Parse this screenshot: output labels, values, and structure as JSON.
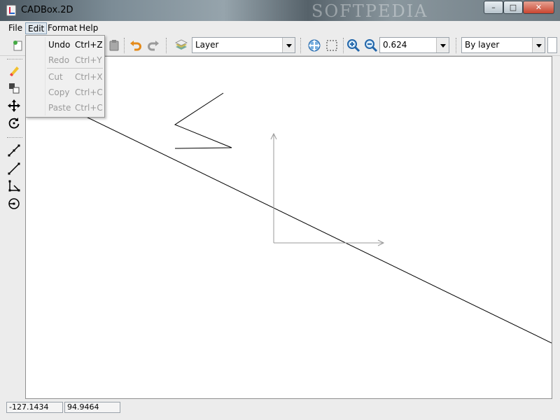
{
  "window": {
    "title": "CADBox.2D",
    "watermark": "SOFTPEDIA",
    "controls": {
      "minimize": "–",
      "maximize": "□",
      "close": "✕"
    }
  },
  "menubar": {
    "items": [
      {
        "label": "File"
      },
      {
        "label": "Edit",
        "active": true
      },
      {
        "label": "Format"
      },
      {
        "label": "Help"
      }
    ]
  },
  "edit_menu": {
    "items": [
      {
        "label": "Undo",
        "shortcut": "Ctrl+Z",
        "enabled": true
      },
      {
        "label": "Redo",
        "shortcut": "Ctrl+Y",
        "enabled": false
      },
      {
        "label": "Cut",
        "shortcut": "Ctrl+X",
        "enabled": false
      },
      {
        "label": "Copy",
        "shortcut": "Ctrl+C",
        "enabled": false
      },
      {
        "label": "Paste",
        "shortcut": "Ctrl+C",
        "enabled": false
      }
    ]
  },
  "toolbar": {
    "icons": [
      "new-icon",
      "paste-icon",
      "undo-icon",
      "redo-icon",
      "layers-icon",
      "pan-icon",
      "zoom-window-icon",
      "zoom-in-icon",
      "zoom-out-icon"
    ],
    "layer_select": {
      "value": "Layer"
    },
    "zoom_select": {
      "value": "0.624"
    },
    "linetype_select": {
      "value": "By layer"
    }
  },
  "palette": {
    "tools": [
      "eraser-icon",
      "copy-objects-icon",
      "move-icon",
      "rotate-icon",
      "dimension-line-icon",
      "line-icon",
      "polyline-icon",
      "circle-icon"
    ]
  },
  "statusbar": {
    "x": "-127.1434",
    "y": "94.9464"
  },
  "colors": {
    "accent_orange": "#e48a1a",
    "zoom_blue": "#2266aa",
    "disabled_text": "#9a9a9a"
  }
}
